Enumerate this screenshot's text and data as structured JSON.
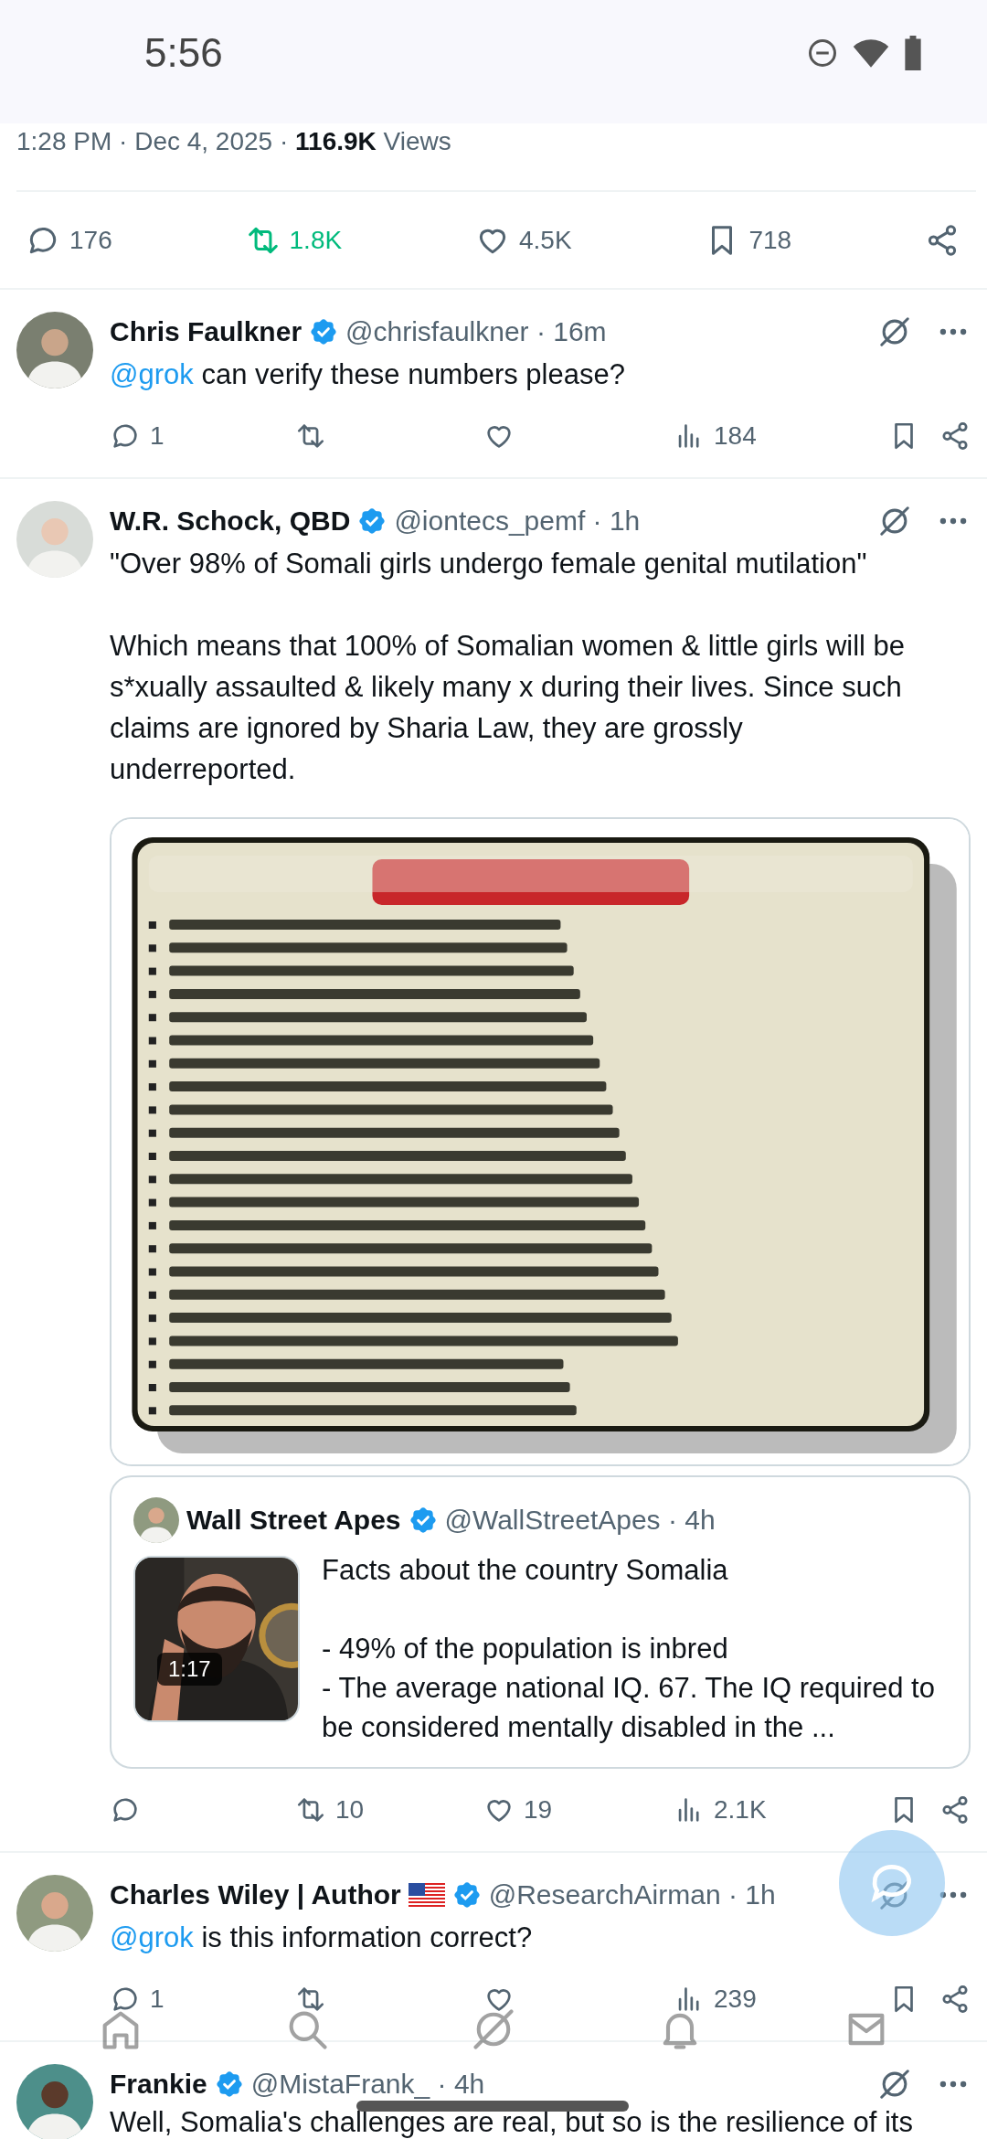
{
  "status_bar": {
    "time": "5:56"
  },
  "post_meta": "1:28 PM · Dec 4, 2025 · **116.9K** Views",
  "post_actions": {
    "replies": "176",
    "reposts": "1.8K",
    "reposted": true,
    "likes": "4.5K",
    "bookmarks": "718"
  },
  "replies": [
    {
      "name": "Chris Faulkner",
      "verified": true,
      "flag": false,
      "handle_time": "@chrisfaulkner · 16m",
      "mention": "@grok",
      "text": "can verify these numbers please?",
      "actions": {
        "replies": "1",
        "views": "184"
      }
    },
    {
      "name": "W.R. Schock, QBD",
      "verified": true,
      "flag": false,
      "handle_time": "@iontecs_pemf · 1h",
      "text": "\"Over 98% of Somali girls undergo female genital mutilation\"\n\nWhich means that 100% of Somalian women & little girls will be s*xually assaulted & likely many x during their lives. Since such claims are ignored by Sharia Law, they are grossly underreported.",
      "quote": {
        "name": "Wall Street Apes",
        "verified": true,
        "handle_time": "@WallStreetApes · 4h",
        "duration": "1:17",
        "text": "Facts about the country Somalia\n\n- 49% of the population is inbred\n- The average national IQ. 67. The IQ required to be considered mentally disabled in the ..."
      },
      "actions": {
        "reposts": "10",
        "likes": "19",
        "views": "2.1K"
      }
    },
    {
      "name": "Charles Wiley | Author",
      "verified": true,
      "flag": true,
      "handle_time": "@ResearchAirman · 1h",
      "mention": "@grok",
      "text": "is this information correct?",
      "actions": {
        "replies": "1",
        "views": "239"
      }
    },
    {
      "name": "Frankie",
      "verified": true,
      "flag": false,
      "handle_time": "@MistaFrank_ · 4h",
      "text": "Well, Somalia's challenges are real, but so is the resilience of its"
    }
  ]
}
